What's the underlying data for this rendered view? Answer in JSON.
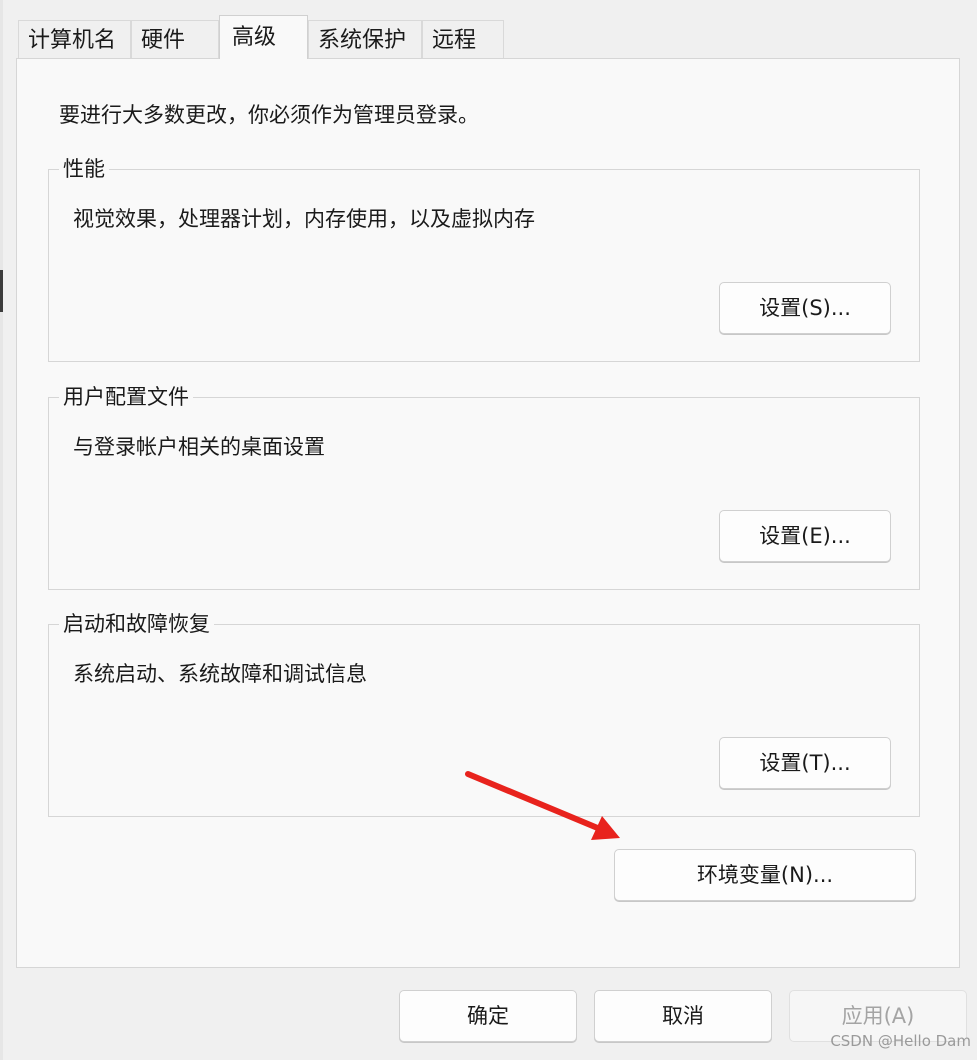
{
  "tabs": [
    {
      "label": "计算机名"
    },
    {
      "label": "硬件"
    },
    {
      "label": "高级"
    },
    {
      "label": "系统保护"
    },
    {
      "label": "远程"
    }
  ],
  "intro_text": "要进行大多数更改，你必须作为管理员登录。",
  "groups": {
    "performance": {
      "title": "性能",
      "description": "视觉效果，处理器计划，内存使用，以及虚拟内存",
      "button": "设置(S)..."
    },
    "user_profiles": {
      "title": "用户配置文件",
      "description": "与登录帐户相关的桌面设置",
      "button": "设置(E)..."
    },
    "startup_recovery": {
      "title": "启动和故障恢复",
      "description": "系统启动、系统故障和调试信息",
      "button": "设置(T)..."
    }
  },
  "env_button": "环境变量(N)...",
  "footer": {
    "ok": "确定",
    "cancel": "取消",
    "apply": "应用(A)"
  },
  "annotation": {
    "arrow_color": "#e8231d",
    "icon": "red-arrow-icon"
  },
  "watermark": "CSDN @Hello Dam"
}
